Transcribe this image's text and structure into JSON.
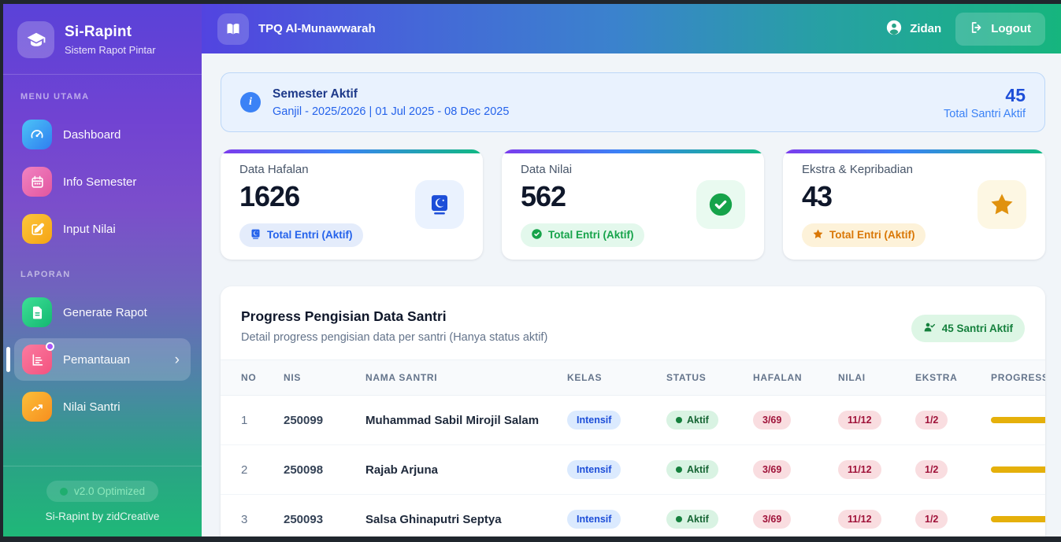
{
  "app": {
    "name": "Si-Rapint",
    "tagline": "Sistem Rapot Pintar"
  },
  "sidebar": {
    "menu_section_label": "MENU UTAMA",
    "report_section_label": "LAPORAN",
    "items": {
      "dashboard": "Dashboard",
      "info_semester": "Info Semester",
      "input_nilai": "Input Nilai",
      "generate_rapot": "Generate Rapot",
      "pemantauan": "Pemantauan",
      "nilai_santri": "Nilai Santri"
    },
    "footer": {
      "version_badge": "v2.0 Optimized",
      "credit": "Si-Rapint by zidCreative"
    }
  },
  "header": {
    "school_name": "TPQ Al-Munawwarah",
    "user_name": "Zidan",
    "logout_label": "Logout"
  },
  "banner": {
    "title": "Semester Aktif",
    "detail": "Ganjil - 2025/2026 | 01 Jul 2025 - 08 Dec 2025",
    "total_value": "45",
    "total_label": "Total Santri Aktif"
  },
  "stats": [
    {
      "label": "Data Hafalan",
      "value": "1626",
      "badge_label": "Total Entri (Aktif)",
      "icon": "quran-icon",
      "color": "#2563eb"
    },
    {
      "label": "Data Nilai",
      "value": "562",
      "badge_label": "Total Entri (Aktif)",
      "icon": "check-circle-icon",
      "color": "#16a34a"
    },
    {
      "label": "Ekstra & Kepribadian",
      "value": "43",
      "badge_label": "Total Entri (Aktif)",
      "icon": "star-icon",
      "color": "#d97706"
    }
  ],
  "progress_section": {
    "title": "Progress Pengisian Data Santri",
    "subtitle": "Detail progress pengisian data per santri (Hanya status aktif)",
    "active_badge": "45 Santri Aktif",
    "columns": [
      "NO",
      "NIS",
      "NAMA SANTRI",
      "KELAS",
      "STATUS",
      "HAFALAN",
      "NILAI",
      "EKSTRA",
      "PROGRESS"
    ],
    "rows": [
      {
        "no": "1",
        "nis": "250099",
        "nama": "Muhammad Sabil Mirojil Salam",
        "kelas": "Intensif",
        "status": "Aktif",
        "hafalan": "3/69",
        "nilai": "11/12",
        "ekstra": "1/2"
      },
      {
        "no": "2",
        "nis": "250098",
        "nama": "Rajab Arjuna",
        "kelas": "Intensif",
        "status": "Aktif",
        "hafalan": "3/69",
        "nilai": "11/12",
        "ekstra": "1/2"
      },
      {
        "no": "3",
        "nis": "250093",
        "nama": "Salsa Ghinaputri Septya",
        "kelas": "Intensif",
        "status": "Aktif",
        "hafalan": "3/69",
        "nilai": "11/12",
        "ekstra": "1/2"
      }
    ]
  },
  "palette": {
    "sidebar_top": "#5a42d8",
    "sidebar_bottom": "#1fb878",
    "header_left": "#5244e0",
    "header_right": "#16b57e",
    "accent_blue": "#2563eb",
    "accent_green": "#16a34a",
    "accent_amber": "#d97706",
    "progress_gold": "#e5b00b",
    "banner_blue": "#e9f2fe"
  }
}
